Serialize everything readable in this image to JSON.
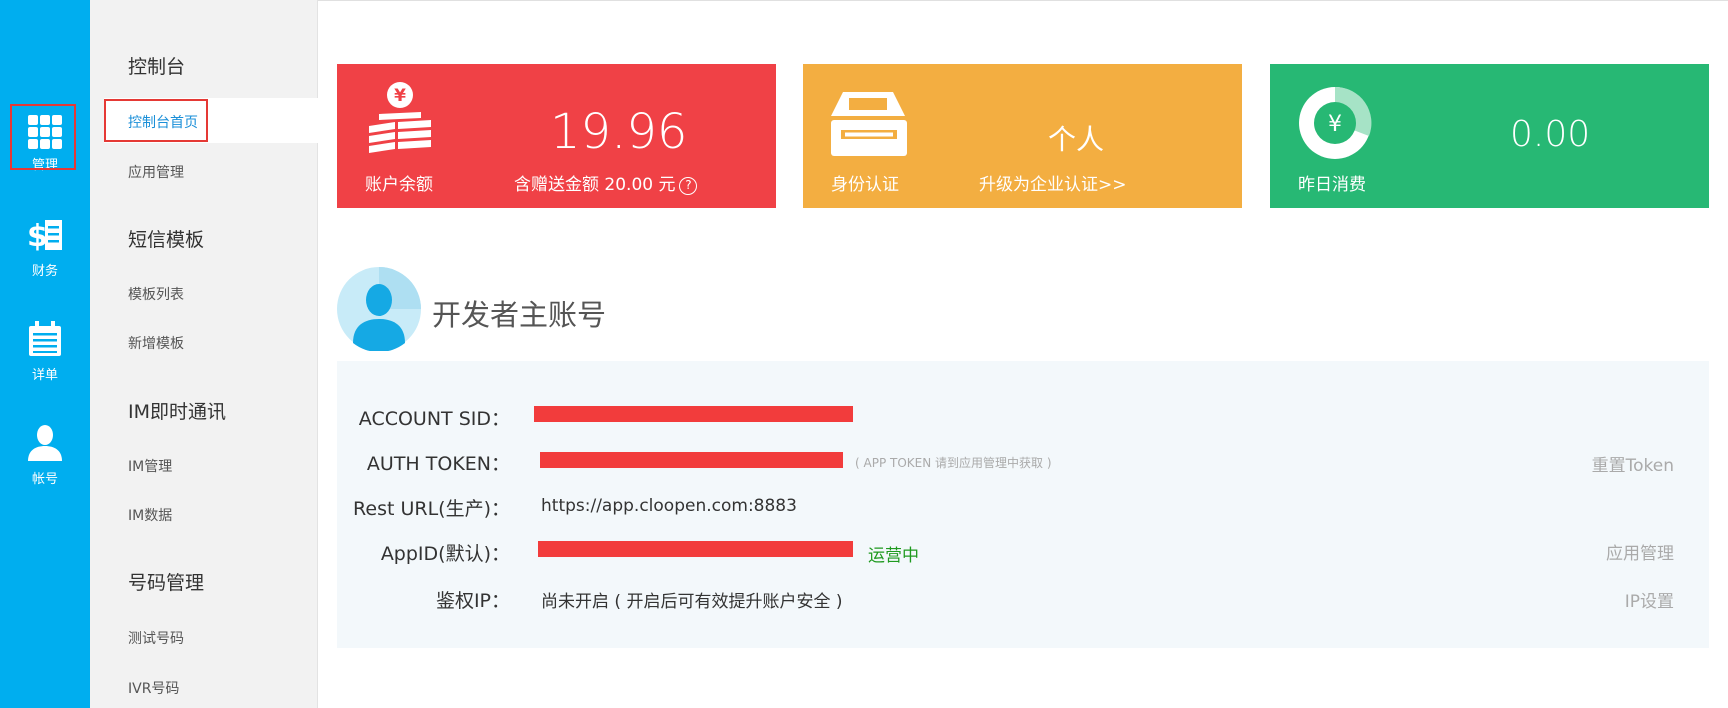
{
  "rail": {
    "items": [
      {
        "label": "管理",
        "icon": "grid-icon"
      },
      {
        "label": "财务",
        "icon": "finance-icon"
      },
      {
        "label": "详单",
        "icon": "calendar-icon"
      },
      {
        "label": "帐号",
        "icon": "user-icon"
      }
    ]
  },
  "submenu": {
    "sections": [
      {
        "title": "控制台",
        "items": [
          "控制台首页",
          "应用管理"
        ]
      },
      {
        "title": "短信模板",
        "items": [
          "模板列表",
          "新增模板"
        ]
      },
      {
        "title": "IM即时通讯",
        "items": [
          "IM管理",
          "IM数据"
        ]
      },
      {
        "title": "号码管理",
        "items": [
          "测试号码",
          "IVR号码"
        ]
      }
    ]
  },
  "cards": {
    "balance": {
      "label": "账户余额",
      "value": "19.96",
      "gift": "含赠送金额 20.00 元",
      "help": "?"
    },
    "identity": {
      "label": "身份认证",
      "value": "个人",
      "upgrade": "升级为企业认证>>"
    },
    "yesterday": {
      "label": "昨日消费",
      "value": "0.00"
    }
  },
  "account": {
    "title": "开发者主账号",
    "rows": {
      "sid_label": "ACCOUNT SID：",
      "token_label": "AUTH TOKEN：",
      "token_note": "( APP TOKEN 请到应用管理中获取 )",
      "token_action": "重置Token",
      "rest_label": "Rest URL(生产)：",
      "rest_value": "https://app.cloopen.com:8883",
      "appid_label": "AppID(默认)：",
      "appid_status": "运营中",
      "appid_action": "应用管理",
      "ip_label": "鉴权IP：",
      "ip_value": "尚未开启 ( 开启后可有效提升账户安全 )",
      "ip_action": "IP设置"
    }
  },
  "colors": {
    "rail": "#00aeef",
    "red": "#f04146",
    "orange": "#f3ae41",
    "green": "#27b874",
    "redaction": "#f23c3c",
    "status_green": "#1f9a1f"
  }
}
